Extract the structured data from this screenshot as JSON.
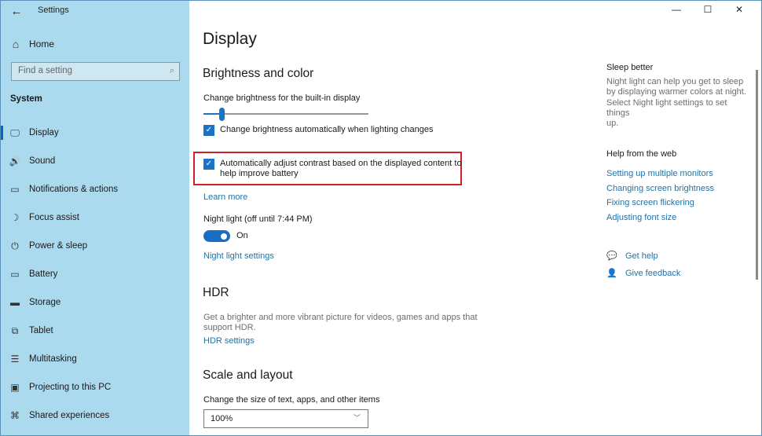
{
  "window": {
    "title": "Settings",
    "controls": {
      "minimize": "—",
      "maximize": "☐",
      "close": "✕"
    }
  },
  "sidebar": {
    "back_icon": "←",
    "home": {
      "icon": "⌂",
      "label": "Home"
    },
    "search": {
      "placeholder": "Find a setting",
      "icon": "⌕"
    },
    "section": "System",
    "items": [
      {
        "icon": "🖵",
        "label": "Display",
        "active": true
      },
      {
        "icon": "🔊",
        "label": "Sound"
      },
      {
        "icon": "▭",
        "label": "Notifications & actions"
      },
      {
        "icon": "☽",
        "label": "Focus assist"
      },
      {
        "icon": "⏻",
        "label": "Power & sleep"
      },
      {
        "icon": "▭",
        "label": "Battery"
      },
      {
        "icon": "▬",
        "label": "Storage"
      },
      {
        "icon": "⧉",
        "label": "Tablet"
      },
      {
        "icon": "☰",
        "label": "Multitasking"
      },
      {
        "icon": "▣",
        "label": "Projecting to this PC"
      },
      {
        "icon": "⌘",
        "label": "Shared experiences"
      }
    ]
  },
  "main": {
    "title": "Display",
    "brightness": {
      "heading": "Brightness and color",
      "slider_label": "Change brightness for the built-in display",
      "slider_value_percent": 11,
      "auto_brightness": {
        "checked": true,
        "label": "Change brightness automatically when lighting changes"
      },
      "auto_contrast": {
        "checked": true,
        "label_line1": "Automatically adjust contrast based on the displayed content to",
        "label_line2": "help improve battery"
      },
      "learn_more": "Learn more",
      "night_light_label": "Night light (off until 7:44 PM)",
      "night_light_toggle": {
        "on": true,
        "label": "On"
      },
      "night_light_settings": "Night light settings"
    },
    "hdr": {
      "heading": "HDR",
      "desc_line1": "Get a brighter and more vibrant picture for videos, games and apps that",
      "desc_line2": "support HDR.",
      "link": "HDR settings"
    },
    "scale": {
      "heading": "Scale and layout",
      "label": "Change the size of text, apps, and other items",
      "value": "100%",
      "chevron": "﹀"
    }
  },
  "right": {
    "sleep_heading": "Sleep better",
    "sleep_lines": [
      "Night light can help you get to sleep",
      "by displaying warmer colors at night.",
      "Select Night light settings to set things",
      "up."
    ],
    "web_heading": "Help from the web",
    "web_links": [
      "Setting up multiple monitors",
      "Changing screen brightness",
      "Fixing screen flickering",
      "Adjusting font size"
    ],
    "get_help": {
      "icon": "💬",
      "label": "Get help"
    },
    "give_feedback": {
      "icon": "👤",
      "label": "Give feedback"
    }
  },
  "colors": {
    "accent": "#1a73c7",
    "sidebar_bg": "#abd9ee",
    "link": "#1f72a8",
    "highlight": "#d0202b"
  }
}
